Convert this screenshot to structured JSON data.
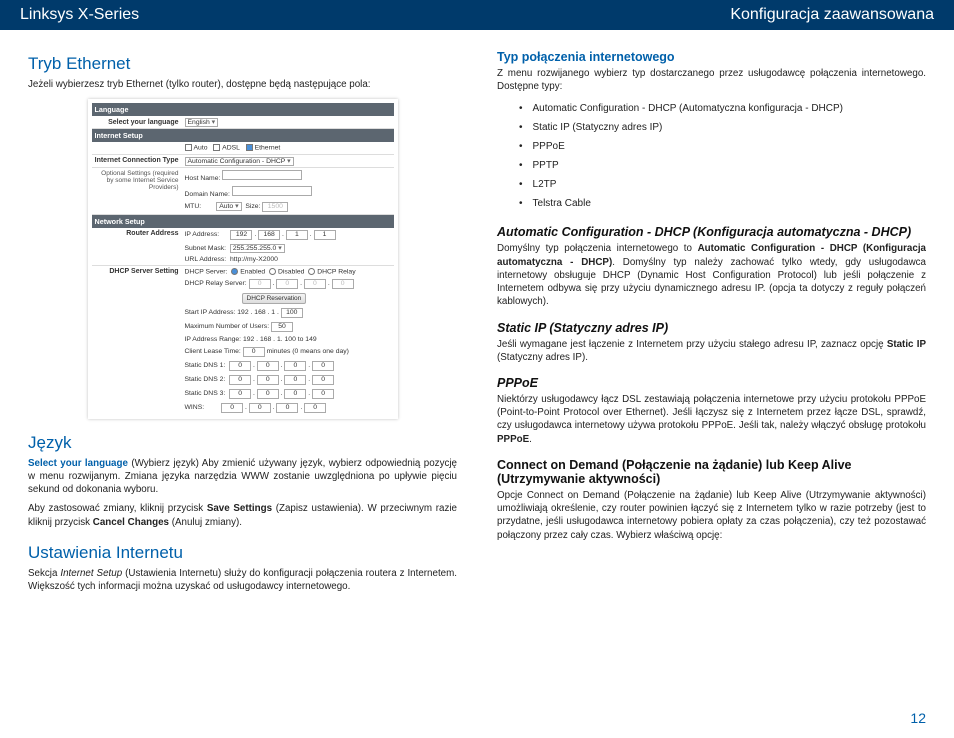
{
  "header": {
    "left": "Linksys X-Series",
    "right": "Konfiguracja zaawansowana"
  },
  "pageNumber": "12",
  "left": {
    "h_ethernet": "Tryb Ethernet",
    "p_ethernet": "Jeżeli wybierzesz tryb Ethernet (tylko router), dostępne będą następujące pola:",
    "h_jezyk": "Język",
    "p_jezyk1_lead": "Select your language",
    "p_jezyk1_rest": " (Wybierz język) Aby zmienić używany język, wybierz odpowiednią pozycję w menu rozwijanym. Zmiana języka narzędzia WWW zostanie uwzględniona po upływie pięciu sekund od dokonania wyboru.",
    "p_jezyk2_a": "Aby zastosować zmiany, kliknij przycisk ",
    "p_jezyk2_b": "Save Settings",
    "p_jezyk2_c": " (Zapisz ustawienia). W przeciwnym razie kliknij przycisk ",
    "p_jezyk2_d": "Cancel Changes",
    "p_jezyk2_e": " (Anuluj zmiany).",
    "h_ust": "Ustawienia Internetu",
    "p_ust_a": "Sekcja ",
    "p_ust_b": "Internet Setup",
    "p_ust_c": " (Ustawienia Internetu) służy do konfiguracji połączenia routera z Internetem. Większość tych informacji można uzyskać od usługodawcy internetowego."
  },
  "right": {
    "h_typ": "Typ połączenia internetowego",
    "p_typ": "Z menu rozwijanego wybierz typ dostarczanego przez usługodawcę połączenia internetowego. Dostępne typy:",
    "bullets": [
      "Automatic Configuration - DHCP (Automatyczna konfiguracja - DHCP)",
      "Static IP (Statyczny adres IP)",
      "PPPoE",
      "PPTP",
      "L2TP",
      "Telstra Cable"
    ],
    "h_dhcp": "Automatic Configuration - DHCP (Konfiguracja automatyczna - DHCP)",
    "p_dhcp_a": "Domyślny typ połączenia internetowego to ",
    "p_dhcp_b": "Automatic Configuration - DHCP (Konfiguracja automatyczna - DHCP)",
    "p_dhcp_c": ". Domyślny typ należy zachować tylko wtedy, gdy usługodawca internetowy obsługuje DHCP (Dynamic Host Configuration Protocol) lub jeśli połączenie z Internetem odbywa się przy użyciu dynamicznego adresu IP. (opcja ta dotyczy z reguły połączeń kablowych).",
    "h_static": "Static IP (Statyczny adres IP)",
    "p_static_a": "Jeśli wymagane jest łączenie z Internetem przy użyciu stałego adresu IP, zaznacz opcję ",
    "p_static_b": "Static IP",
    "p_static_c": " (Statyczny adres IP).",
    "h_pppoe": "PPPoE",
    "p_pppoe_a": "Niektórzy usługodawcy łącz DSL zestawiają połączenia internetowe przy użyciu protokołu PPPoE (Point-to-Point Protocol over Ethernet). Jeśli łączysz się z Internetem przez łącze DSL, sprawdź, czy usługodawca internetowy używa protokołu PPPoE. Jeśli tak, należy włączyć obsługę protokołu ",
    "p_pppoe_b": "PPPoE",
    "p_pppoe_c": ".",
    "h_connect": "Connect on Demand (Połączenie na żądanie) lub Keep Alive (Utrzymywanie aktywności)",
    "p_connect": "Opcje Connect on Demand (Połączenie na żądanie) lub Keep Alive (Utrzymywanie aktywności) umożliwiają określenie, czy router powinien łączyć się z Internetem tylko w razie potrzeby (jest to przydatne, jeśli usługodawca internetowy pobiera opłaty za czas połączenia), czy też pozostawać połączony przez cały czas. Wybierz właściwą opcję:"
  },
  "shot": {
    "sec_lang": "Language",
    "lbl_selectlang": "Select your language",
    "val_lang": "English",
    "sec_inet": "Internet Setup",
    "opt_auto": "Auto",
    "opt_adsl": "ADSL",
    "opt_eth": "Ethernet",
    "lbl_conntype": "Internet Connection Type",
    "val_conntype": "Automatic Configuration - DHCP",
    "lbl_optional": "Optional Settings (required by some Internet Service Providers)",
    "lbl_hostname": "Host Name:",
    "lbl_domainname": "Domain Name:",
    "lbl_mtu": "MTU:",
    "val_mtu_mode": "Auto",
    "lbl_size": "Size:",
    "val_mtu_size": "1500",
    "sec_net": "Network Setup",
    "lbl_router": "Router Address",
    "lbl_ip": "IP Address:",
    "ip": [
      "192",
      "168",
      "1",
      "1"
    ],
    "lbl_subnet": "Subnet Mask:",
    "val_subnet": "255.255.255.0",
    "lbl_url": "URL Address:",
    "val_url": "http://my-X2000",
    "lbl_dhcpset": "DHCP Server Setting",
    "lbl_dhcpserver": "DHCP Server:",
    "opt_enabled": "Enabled",
    "opt_disabled": "Disabled",
    "opt_relay": "DHCP Relay",
    "lbl_relaysrv": "DHCP Relay Server:",
    "relay": [
      "0",
      "0",
      "0",
      "0"
    ],
    "btn_reserv": "DHCP Reservation",
    "lbl_startip": "Start IP Address:",
    "val_startip_prefix": "192 . 168 . 1 .",
    "val_startip_last": "100",
    "lbl_maxusers": "Maximum Number of Users:",
    "val_maxusers": "50",
    "lbl_iprange": "IP Address Range:",
    "val_iprange": "192 . 168 . 1. 100 to 149",
    "lbl_lease": "Client Lease Time:",
    "val_lease": "0",
    "lbl_lease_suffix": "minutes (0 means one day)",
    "lbl_dns1": "Static DNS 1:",
    "lbl_dns2": "Static DNS 2:",
    "lbl_dns3": "Static DNS 3:",
    "lbl_wins": "WINS:",
    "zeros": [
      "0",
      "0",
      "0",
      "0"
    ]
  }
}
